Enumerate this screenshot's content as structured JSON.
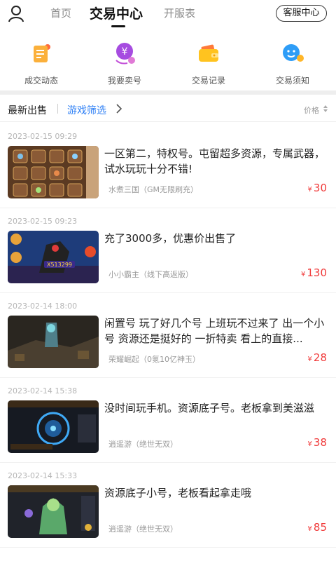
{
  "header": {
    "tabs": [
      {
        "label": "首页"
      },
      {
        "label": "交易中心"
      },
      {
        "label": "开服表"
      }
    ],
    "service_label": "客服中心"
  },
  "quicknav": [
    {
      "label": "成交动态",
      "icon": "deals-icon",
      "color": "#fbb03b"
    },
    {
      "label": "我要卖号",
      "icon": "sell-icon",
      "color": "#a64ce0"
    },
    {
      "label": "交易记录",
      "icon": "wallet-icon",
      "color": "#ffc31f"
    },
    {
      "label": "交易须知",
      "icon": "notice-icon",
      "color": "#2e9df7"
    }
  ],
  "filter": {
    "latest_label": "最新出售",
    "game_filter_label": "游戏筛选",
    "price_label": "价格"
  },
  "listings": [
    {
      "date": "2023-02-15 09:29",
      "title": "一区第二，特权号。屯留超多资源，专属武器，试水玩玩十分不错!",
      "game": "水煮三国（GM无限刷充）",
      "currency": "¥",
      "price": "30"
    },
    {
      "date": "2023-02-15 09:23",
      "title": "充了3000多，优惠价出售了",
      "game": "小小霸主（线下高返版）",
      "currency": "¥",
      "price": "130"
    },
    {
      "date": "2023-02-14 18:00",
      "title": "闲置号 玩了好几个号 上班玩不过来了 出一个小号 资源还是挺好的 一折特卖 看上的直接...",
      "game": "荣耀崛起（0氪10亿神玉）",
      "currency": "¥",
      "price": "28"
    },
    {
      "date": "2023-02-14 15:38",
      "title": "没时间玩手机。资源底子号。老板拿到美滋滋",
      "game": "逍遥游（绝世无双）",
      "currency": "¥",
      "price": "38"
    },
    {
      "date": "2023-02-14 15:33",
      "title": "资源底子小号，老板看起拿走哦",
      "game": "逍遥游（绝世无双）",
      "currency": "¥",
      "price": "85"
    }
  ],
  "colors": {
    "accent_blue": "#2a7df5",
    "price_red": "#f03a3a"
  }
}
